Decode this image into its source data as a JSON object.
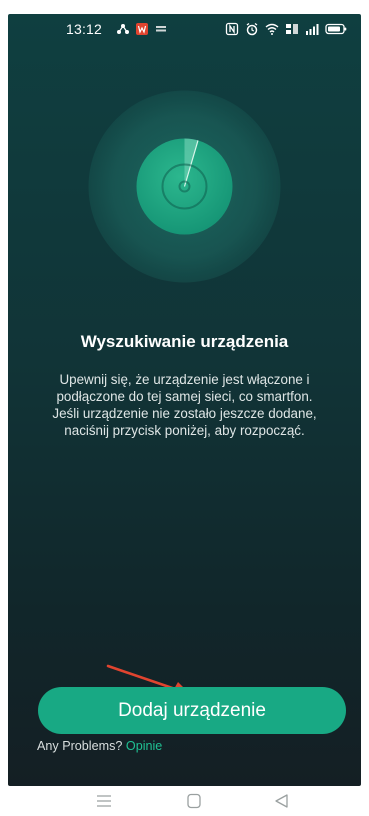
{
  "status_bar": {
    "time": "13:12",
    "left_icons": [
      "network-icon",
      "app-notification-icon",
      "small-app-icon"
    ],
    "right_icons": [
      "nfc-icon",
      "alarm-icon",
      "wifi-icon",
      "volte-icon",
      "signal-icon",
      "battery-icon"
    ]
  },
  "scan": {
    "icon": "disc-radar-icon",
    "title": "Wyszukiwanie urządzenia",
    "description_lines": [
      "Upewnij się, że urządzenie jest włączone i",
      "podłączone do tej samej sieci, co smartfon.",
      "Jeśli urządzenie nie zostało jeszcze dodane,",
      "naciśnij przycisk poniżej, aby rozpocząć."
    ]
  },
  "actions": {
    "add_device_label": "Dodaj urządzenie",
    "problems_prefix": "Any Problems?",
    "problems_link": "Opinie"
  },
  "annotation": {
    "arrow_color": "#e0442f"
  },
  "colors": {
    "accent": "#18a984",
    "link": "#1fc193",
    "background_top": "#0f3f40",
    "background_bottom": "#141f24"
  },
  "nav_bar": {
    "icons": [
      "menu-icon",
      "home-icon",
      "back-icon"
    ]
  }
}
